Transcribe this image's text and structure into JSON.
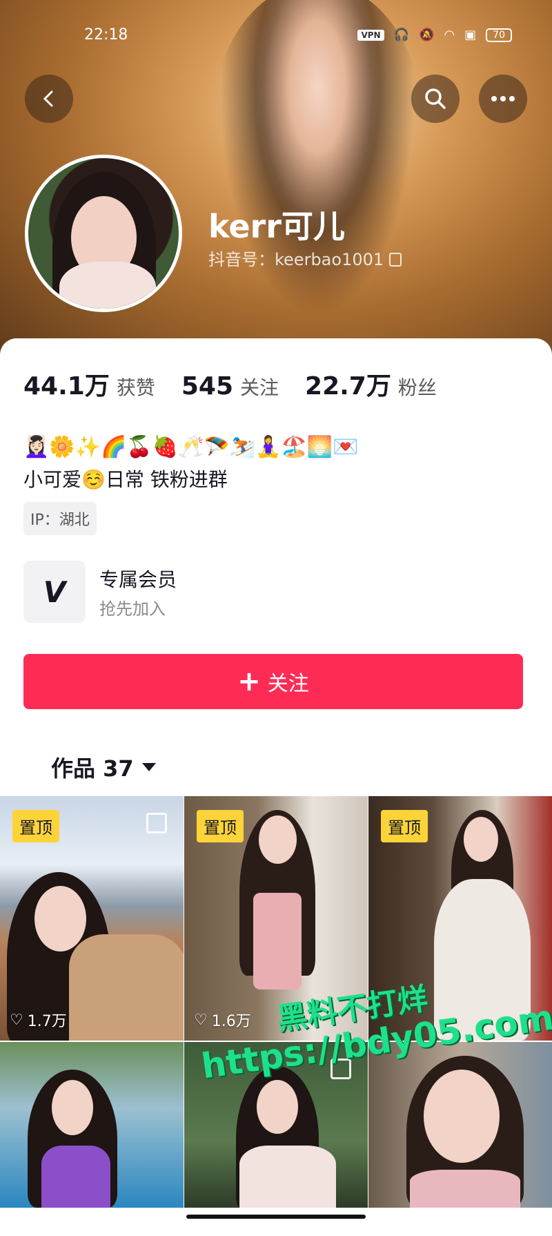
{
  "status_bar": {
    "time": "22:18",
    "vpn": "VPN",
    "battery": "70"
  },
  "profile": {
    "name": "kerr可儿",
    "douyin_id": "抖音号：keerbao1001",
    "stats": [
      {
        "value": "44.1万",
        "label": "获赞"
      },
      {
        "value": "545",
        "label": "关注"
      },
      {
        "value": "22.7万",
        "label": "粉丝"
      }
    ],
    "emoji_line": "💆🏻‍♀️🌼✨🌈🍒🍓🥂🪂⛷️🧘‍♀️🏖️🌅💌",
    "bio": "小可爱☺️日常 铁粉进群",
    "ip": "IP：湖北"
  },
  "member": {
    "title": "专属会员",
    "subtitle": "抢先加入",
    "icon_glyph": "V"
  },
  "follow_button": {
    "plus": "+",
    "label": "关注"
  },
  "works_tab": {
    "label": "作品 37"
  },
  "videos": [
    {
      "pinned": "置顶",
      "likes": "1.7万"
    },
    {
      "pinned": "置顶",
      "likes": "1.6万"
    },
    {
      "pinned": "置顶",
      "likes": ""
    },
    {
      "pinned": "",
      "likes": ""
    },
    {
      "pinned": "",
      "likes": ""
    },
    {
      "pinned": "",
      "likes": ""
    }
  ],
  "watermark": {
    "line1": "黑料不打烊",
    "line2": "https://bdy05.com"
  },
  "colors": {
    "accent": "#fe2c55",
    "pin_badge": "#fdd33a",
    "watermark": "#1ee08c"
  }
}
